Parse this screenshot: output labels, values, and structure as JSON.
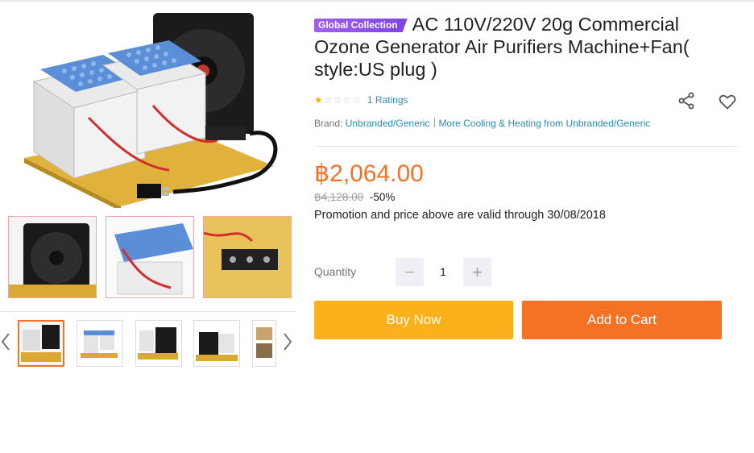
{
  "product": {
    "badge": "Global Collection",
    "title": "AC 110V/220V 20g Commercial Ozone Generator Air Purifiers Machine+Fan( style:US plug )",
    "rating": {
      "stars_filled": 1,
      "stars_total": 5,
      "count_text": "1 Ratings"
    },
    "brand_label": "Brand:",
    "brand_name": "Unbranded/Generic",
    "more_link": "More Cooling & Heating from Unbranded/Generic",
    "price": "฿2,064.00",
    "original_price": "฿4,128.00",
    "discount": "-50%",
    "promo_text": "Promotion and price above are valid through 30/08/2018"
  },
  "quantity": {
    "label": "Quantity",
    "value": "1",
    "minus": "−",
    "plus": "+"
  },
  "actions": {
    "buy_now": "Buy Now",
    "add_to_cart": "Add to Cart"
  },
  "icons": {
    "share": "share-icon",
    "wishlist": "heart-icon",
    "prev": "chevron-left-icon",
    "next": "chevron-right-icon"
  },
  "colors": {
    "accent": "#f57224",
    "buy_now": "#fbb11b",
    "link": "#2a8bb6",
    "badge": "#8c4ff0"
  }
}
